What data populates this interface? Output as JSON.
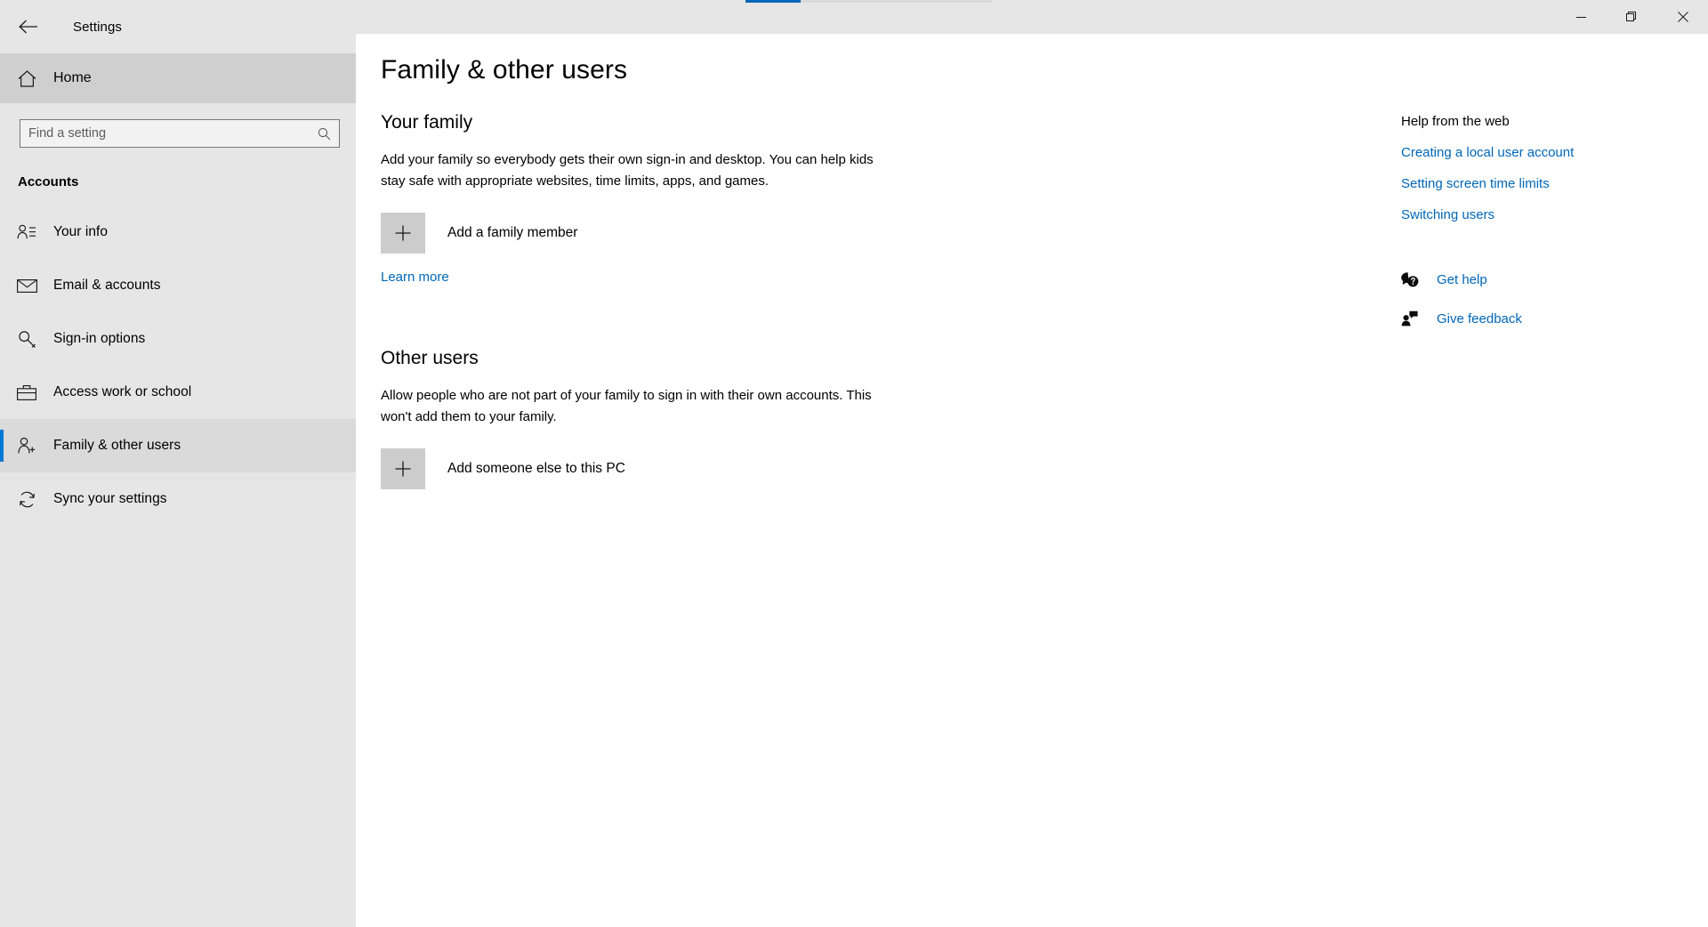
{
  "window": {
    "app_title": "Settings",
    "back_icon": "back-arrow-icon",
    "controls": {
      "minimize": "minimize-icon",
      "maximize": "maximize-restore-icon",
      "close": "close-icon"
    },
    "accent_color": "#0078d4",
    "link_color": "#0067b8",
    "titlebar_bg": "#e6e6e6",
    "sidebar_bg": "#e6e6e6"
  },
  "sidebar": {
    "home": {
      "label": "Home",
      "icon": "home-icon"
    },
    "search": {
      "placeholder": "Find a setting",
      "value": "",
      "icon": "search-icon"
    },
    "category": "Accounts",
    "items": [
      {
        "label": "Your info",
        "icon": "user-info-icon",
        "selected": false
      },
      {
        "label": "Email & accounts",
        "icon": "envelope-icon",
        "selected": false
      },
      {
        "label": "Sign-in options",
        "icon": "key-icon",
        "selected": false
      },
      {
        "label": "Access work or school",
        "icon": "briefcase-icon",
        "selected": false
      },
      {
        "label": "Family & other users",
        "icon": "add-user-icon",
        "selected": true
      },
      {
        "label": "Sync your settings",
        "icon": "sync-refresh-icon",
        "selected": false
      }
    ]
  },
  "main": {
    "page_title": "Family & other users",
    "sections": [
      {
        "heading": "Your family",
        "body": "Add your family so everybody gets their own sign-in and desktop. You can help kids stay safe with appropriate websites, time limits, apps, and games.",
        "action": {
          "label": "Add a family member",
          "icon": "plus-icon"
        },
        "link": "Learn more"
      },
      {
        "heading": "Other users",
        "body": "Allow people who are not part of your family to sign in with their own accounts. This won't add them to your family.",
        "action": {
          "label": "Add someone else to this PC",
          "icon": "plus-icon"
        },
        "link": ""
      }
    ]
  },
  "help": {
    "title": "Help from the web",
    "links": [
      "Creating a local user account",
      "Setting screen time limits",
      "Switching users"
    ],
    "actions": [
      {
        "label": "Get help",
        "icon": "question-chat-icon"
      },
      {
        "label": "Give feedback",
        "icon": "feedback-person-icon"
      }
    ]
  }
}
